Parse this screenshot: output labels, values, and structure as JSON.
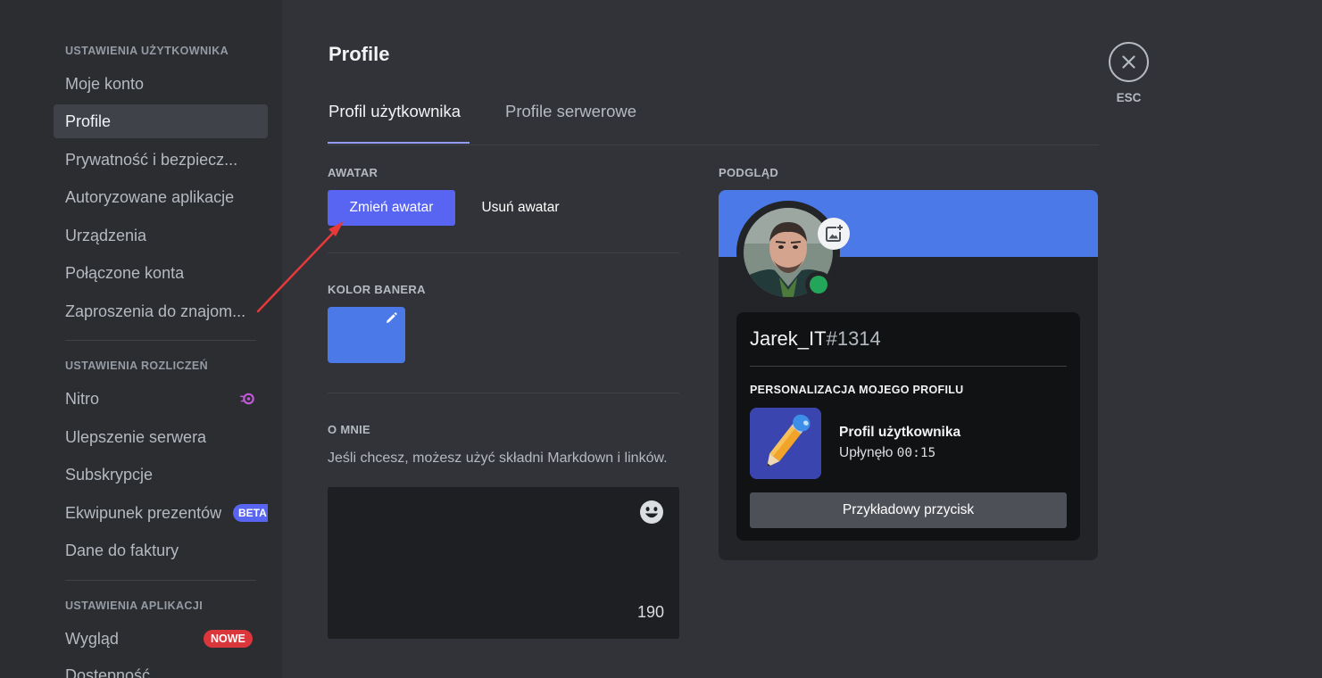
{
  "sidebar": {
    "user_settings_header": "USTAWIENIA UŻYTKOWNIKA",
    "user_items": [
      {
        "label": "Moje konto"
      },
      {
        "label": "Profile"
      },
      {
        "label": "Prywatność i bezpiecz..."
      },
      {
        "label": "Autoryzowane aplikacje"
      },
      {
        "label": "Urządzenia"
      },
      {
        "label": "Połączone konta"
      },
      {
        "label": "Zaproszenia do znajom..."
      }
    ],
    "billing_header": "USTAWIENIA ROZLICZEŃ",
    "billing_items": [
      {
        "label": "Nitro"
      },
      {
        "label": "Ulepszenie serwera"
      },
      {
        "label": "Subskrypcje"
      },
      {
        "label": "Ekwipunek prezentów",
        "badge": "BETA"
      },
      {
        "label": "Dane do faktury"
      }
    ],
    "app_header": "USTAWIENIA APLIKACJI",
    "app_items": [
      {
        "label": "Wygląd",
        "badge": "NOWE"
      },
      {
        "label": "Dostępność"
      }
    ]
  },
  "main": {
    "title": "Profile",
    "tabs": [
      {
        "label": "Profil użytkownika"
      },
      {
        "label": "Profile serwerowe"
      }
    ],
    "avatar_label": "AWATAR",
    "change_avatar": "Zmień awatar",
    "remove_avatar": "Usuń awatar",
    "banner_color_label": "KOLOR BANERA",
    "banner_color": "#4c79e8",
    "about_label": "O MNIE",
    "about_hint": "Jeśli chcesz, możesz użyć składni Markdown i linków.",
    "about_counter": "190"
  },
  "preview": {
    "label": "PODGLĄD",
    "username": "Jarek_IT",
    "discriminator": "#1314",
    "section": "PERSONALIZACJA MOJEGO PROFILU",
    "activity_title": "Profil użytkownika",
    "activity_elapsed_prefix": "Upłynęło ",
    "activity_elapsed": "00:15",
    "sample_button": "Przykładowy przycisk",
    "status": "online"
  },
  "close": {
    "label": "ESC"
  },
  "colors": {
    "accent": "#5865f2",
    "banner": "#4c79e8",
    "online": "#23a55a",
    "annotation_arrow": "#e5393b"
  }
}
